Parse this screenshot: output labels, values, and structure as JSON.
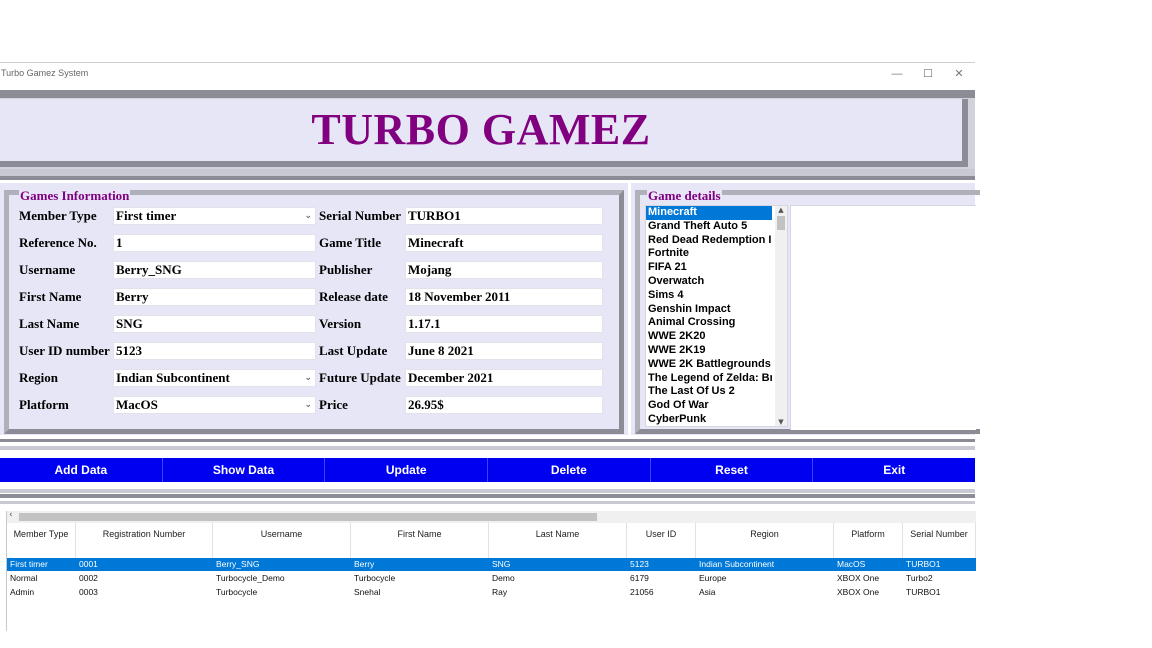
{
  "window": {
    "title": "Turbo Gamez System",
    "min": "—",
    "max": "☐",
    "close": "✕"
  },
  "banner": {
    "title": "TURBO GAMEZ"
  },
  "games_info": {
    "legend": "Games Information",
    "fields": [
      {
        "label": "Member Type",
        "value": "First timer",
        "combo": true
      },
      {
        "label": "Reference No.",
        "value": "1",
        "combo": false
      },
      {
        "label": "Username",
        "value": "Berry_SNG",
        "combo": false
      },
      {
        "label": "First Name",
        "value": "Berry",
        "combo": false
      },
      {
        "label": "Last Name",
        "value": "SNG",
        "combo": false
      },
      {
        "label": "User ID number",
        "value": "5123",
        "combo": false
      },
      {
        "label": "Region",
        "value": "Indian Subcontinent",
        "combo": true
      },
      {
        "label": "Platform",
        "value": "MacOS",
        "combo": true
      }
    ],
    "fields2": [
      {
        "label": "Serial Number",
        "value": "TURBO1"
      },
      {
        "label": "Game Title",
        "value": "Minecraft"
      },
      {
        "label": "Publisher",
        "value": "Mojang"
      },
      {
        "label": "Release date",
        "value": "18 November 2011"
      },
      {
        "label": "Version",
        "value": "1.17.1"
      },
      {
        "label": "Last Update",
        "value": "June 8 2021"
      },
      {
        "label": "Future Update",
        "value": "December 2021"
      },
      {
        "label": "Price",
        "value": "26.95$"
      }
    ]
  },
  "game_details": {
    "legend": "Game details",
    "selected_index": 0,
    "games": [
      "Minecraft",
      "Grand Theft Auto 5",
      "Red Dead Redemption II",
      "Fortnite",
      "FIFA 21",
      "Overwatch",
      "Sims 4",
      "Genshin Impact",
      "Animal Crossing",
      "WWE 2K20",
      "WWE 2K19",
      "WWE 2K Battlegrounds",
      "The Legend of Zelda: Breath of the Wild",
      "The Last Of Us 2",
      "God Of War",
      "CyberPunk"
    ]
  },
  "buttons": [
    "Add Data",
    "Show Data",
    "Update",
    "Delete",
    "Reset",
    "Exit"
  ],
  "grid": {
    "columns": [
      "Member Type",
      "Registration Number",
      "Username",
      "First Name",
      "Last Name",
      "User ID",
      "Region",
      "Platform",
      "Serial Number"
    ],
    "rows": [
      [
        "First timer",
        "0001",
        "Berry_SNG",
        "Berry",
        "SNG",
        "5123",
        "Indian Subcontinent",
        "MacOS",
        "TURBO1"
      ],
      [
        "Normal",
        "0002",
        "Turbocycle_Demo",
        "Turbocycle",
        "Demo",
        "6179",
        "Europe",
        "XBOX One",
        "Turbo2"
      ],
      [
        "Admin",
        "0003",
        "Turbocycle",
        "Snehal",
        "Ray",
        "21056",
        "Asia",
        "XBOX One",
        "TURBO1"
      ]
    ],
    "selected_row": 0
  },
  "colors": {
    "accent_purple": "#800080",
    "button_blue": "#0000f0",
    "selection": "#0078d7",
    "panel": "#e6e6f6",
    "frame": "#8c8c96"
  }
}
